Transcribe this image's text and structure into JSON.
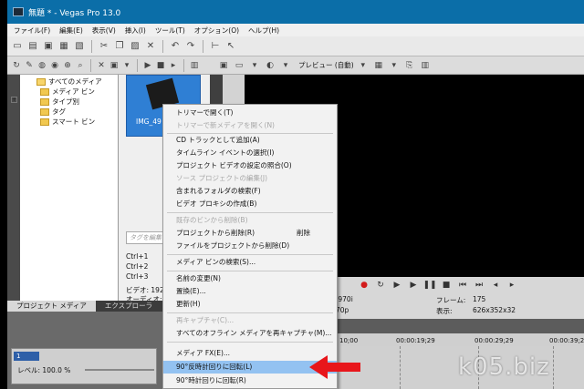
{
  "window": {
    "title": "無題 * - Vegas Pro 13.0"
  },
  "menu": [
    "ファイル(F)",
    "編集(E)",
    "表示(V)",
    "挿入(I)",
    "ツール(T)",
    "オプション(O)",
    "ヘルプ(H)"
  ],
  "tree": {
    "root": "すべてのメディア",
    "items": [
      "メディア ビン",
      "タイプ別",
      "タグ",
      "スマート ビン"
    ]
  },
  "media": {
    "thumb_caption": "IMG_49",
    "tag_placeholder": "タグを編集",
    "shortcuts": [
      "Ctrl+1",
      "Ctrl+2",
      "Ctrl+3"
    ],
    "props": [
      "ビデオ: 1920",
      "オーディオ: 44"
    ]
  },
  "tabs": [
    "プロジェクト メディア",
    "エクスプローラ",
    "ト"
  ],
  "track": {
    "number": "1",
    "level_label": "レベル:",
    "level_value": "100.0 %"
  },
  "preview": {
    "mode_label": "プレビュー (自動)"
  },
  "info": {
    "left1": ".970i",
    "left2": "70p",
    "frame_label": "フレーム:",
    "frame_value": "175",
    "display_label": "表示:",
    "display_value": "626x352x32"
  },
  "ruler": [
    "10;00",
    "00:00:19;29",
    "00:00:29;29",
    "00:00:39;29"
  ],
  "context_menu": {
    "items": [
      {
        "label": "トリマーで開く(T)",
        "disabled": false
      },
      {
        "label": "トリマーで新メディアを開く(N)",
        "disabled": true
      },
      {
        "label": "CD トラックとして追加(A)",
        "disabled": false
      },
      {
        "label": "タイムライン イベントの選択(I)",
        "disabled": false
      },
      {
        "label": "プロジェクト ビデオの設定の照合(O)",
        "disabled": false
      },
      {
        "label": "ソース プロジェクトの編集(J)",
        "disabled": true
      },
      {
        "label": "含まれるフォルダの検索(F)",
        "disabled": false
      },
      {
        "label": "ビデオ プロキシの作成(B)",
        "disabled": false
      },
      {
        "label": "既存のビンから削除(B)",
        "disabled": true
      },
      {
        "label": "プロジェクトから削除(R)",
        "disabled": false,
        "shortcut": "削除"
      },
      {
        "label": "ファイルをプロジェクトから削除(D)",
        "disabled": false
      },
      {
        "label": "メディア ビンの検索(S)...",
        "disabled": false
      },
      {
        "label": "名前の変更(N)",
        "disabled": false
      },
      {
        "label": "置換(E)...",
        "disabled": false
      },
      {
        "label": "更新(H)",
        "disabled": false
      },
      {
        "label": "再キャプチャ(C)...",
        "disabled": true
      },
      {
        "label": "すべてのオフライン メディアを再キャプチャ(M)...",
        "disabled": false
      },
      {
        "label": "メディア FX(E)...",
        "disabled": false
      },
      {
        "label": "90°反時計回りに回転(L)",
        "disabled": false,
        "highlighted": true
      },
      {
        "label": "90°時計回りに回転(R)",
        "disabled": false
      }
    ]
  },
  "watermark": "k05.biz",
  "colors": {
    "titlebar": "#0b6ea8",
    "highlight": "#93c2f1",
    "arrow": "#e8161b"
  }
}
